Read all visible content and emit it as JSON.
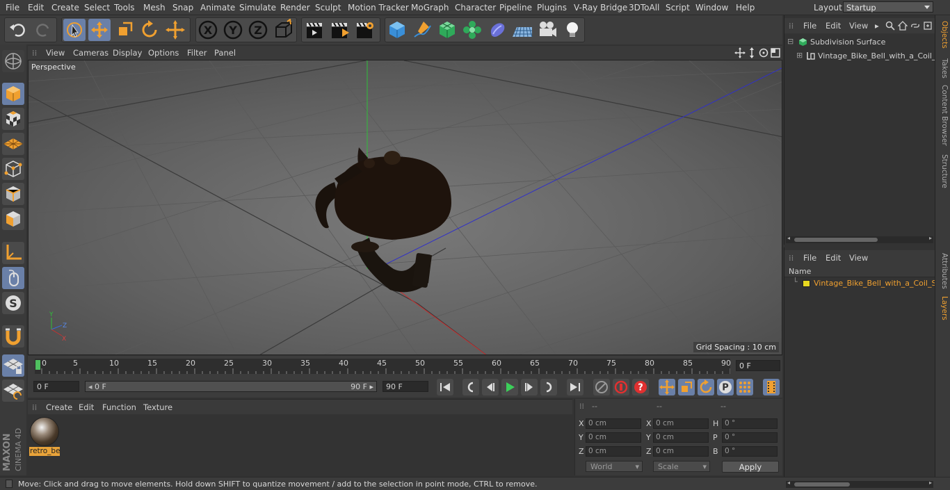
{
  "menubar": {
    "items": [
      "File",
      "Edit",
      "Create",
      "Select",
      "Tools",
      "Mesh",
      "Snap",
      "Animate",
      "Simulate",
      "Render",
      "Sculpt",
      "Motion Tracker",
      "MoGraph",
      "Character",
      "Pipeline",
      "Plugins",
      "V-Ray Bridge",
      "3DToAll",
      "Script",
      "Window",
      "Help"
    ],
    "layout_label": "Layout:",
    "layout_value": "Startup"
  },
  "viewport": {
    "menu": [
      "View",
      "Cameras",
      "Display",
      "Options",
      "Filter",
      "Panel"
    ],
    "label": "Perspective",
    "grid_spacing": "Grid Spacing : 10 cm"
  },
  "timeline": {
    "ticks": [
      "0",
      "5",
      "10",
      "15",
      "20",
      "25",
      "30",
      "35",
      "40",
      "45",
      "50",
      "55",
      "60",
      "65",
      "70",
      "75",
      "80",
      "85",
      "90"
    ],
    "current_frame": "0 F"
  },
  "transport": {
    "start_field": "0 F",
    "range_start": "0 F",
    "range_end": "90 F",
    "end_field": "90 F"
  },
  "material_manager": {
    "menu": [
      "Create",
      "Edit",
      "Function",
      "Texture"
    ],
    "material_name": "retro_bell"
  },
  "coordinates": {
    "header": [
      "--",
      "--",
      "--"
    ],
    "rows": [
      {
        "l1": "X",
        "v1": "0 cm",
        "l2": "X",
        "v2": "0 cm",
        "l3": "H",
        "v3": "0 °"
      },
      {
        "l1": "Y",
        "v1": "0 cm",
        "l2": "Y",
        "v2": "0 cm",
        "l3": "P",
        "v3": "0 °"
      },
      {
        "l1": "Z",
        "v1": "0 cm",
        "l2": "Z",
        "v2": "0 cm",
        "l3": "B",
        "v3": "0 °"
      }
    ],
    "mode_world": "World",
    "mode_scale": "Scale",
    "apply": "Apply"
  },
  "objects_panel": {
    "menu": [
      "File",
      "Edit",
      "View"
    ],
    "tree": [
      "Subdivision Surface",
      "Vintage_Bike_Bell_with_a_Coil_Spring"
    ]
  },
  "layers_panel": {
    "menu": [
      "File",
      "Edit",
      "View"
    ],
    "name_header": "Name",
    "layer": "Vintage_Bike_Bell_with_a_Coil_Spring"
  },
  "right_tabs": [
    "Objects",
    "Takes",
    "Content Browser",
    "Structure",
    "Attributes",
    "Layers"
  ],
  "status": "Move: Click and drag to move elements. Hold down SHIFT to quantize movement / add to the selection in point mode, CTRL to remove.",
  "logo": {
    "line1": "MAXON",
    "line2": "CINEMA 4D"
  },
  "colors": {
    "accent": "#f0a030",
    "active_button": "#6a80a8",
    "layer_color": "#e8d820"
  }
}
